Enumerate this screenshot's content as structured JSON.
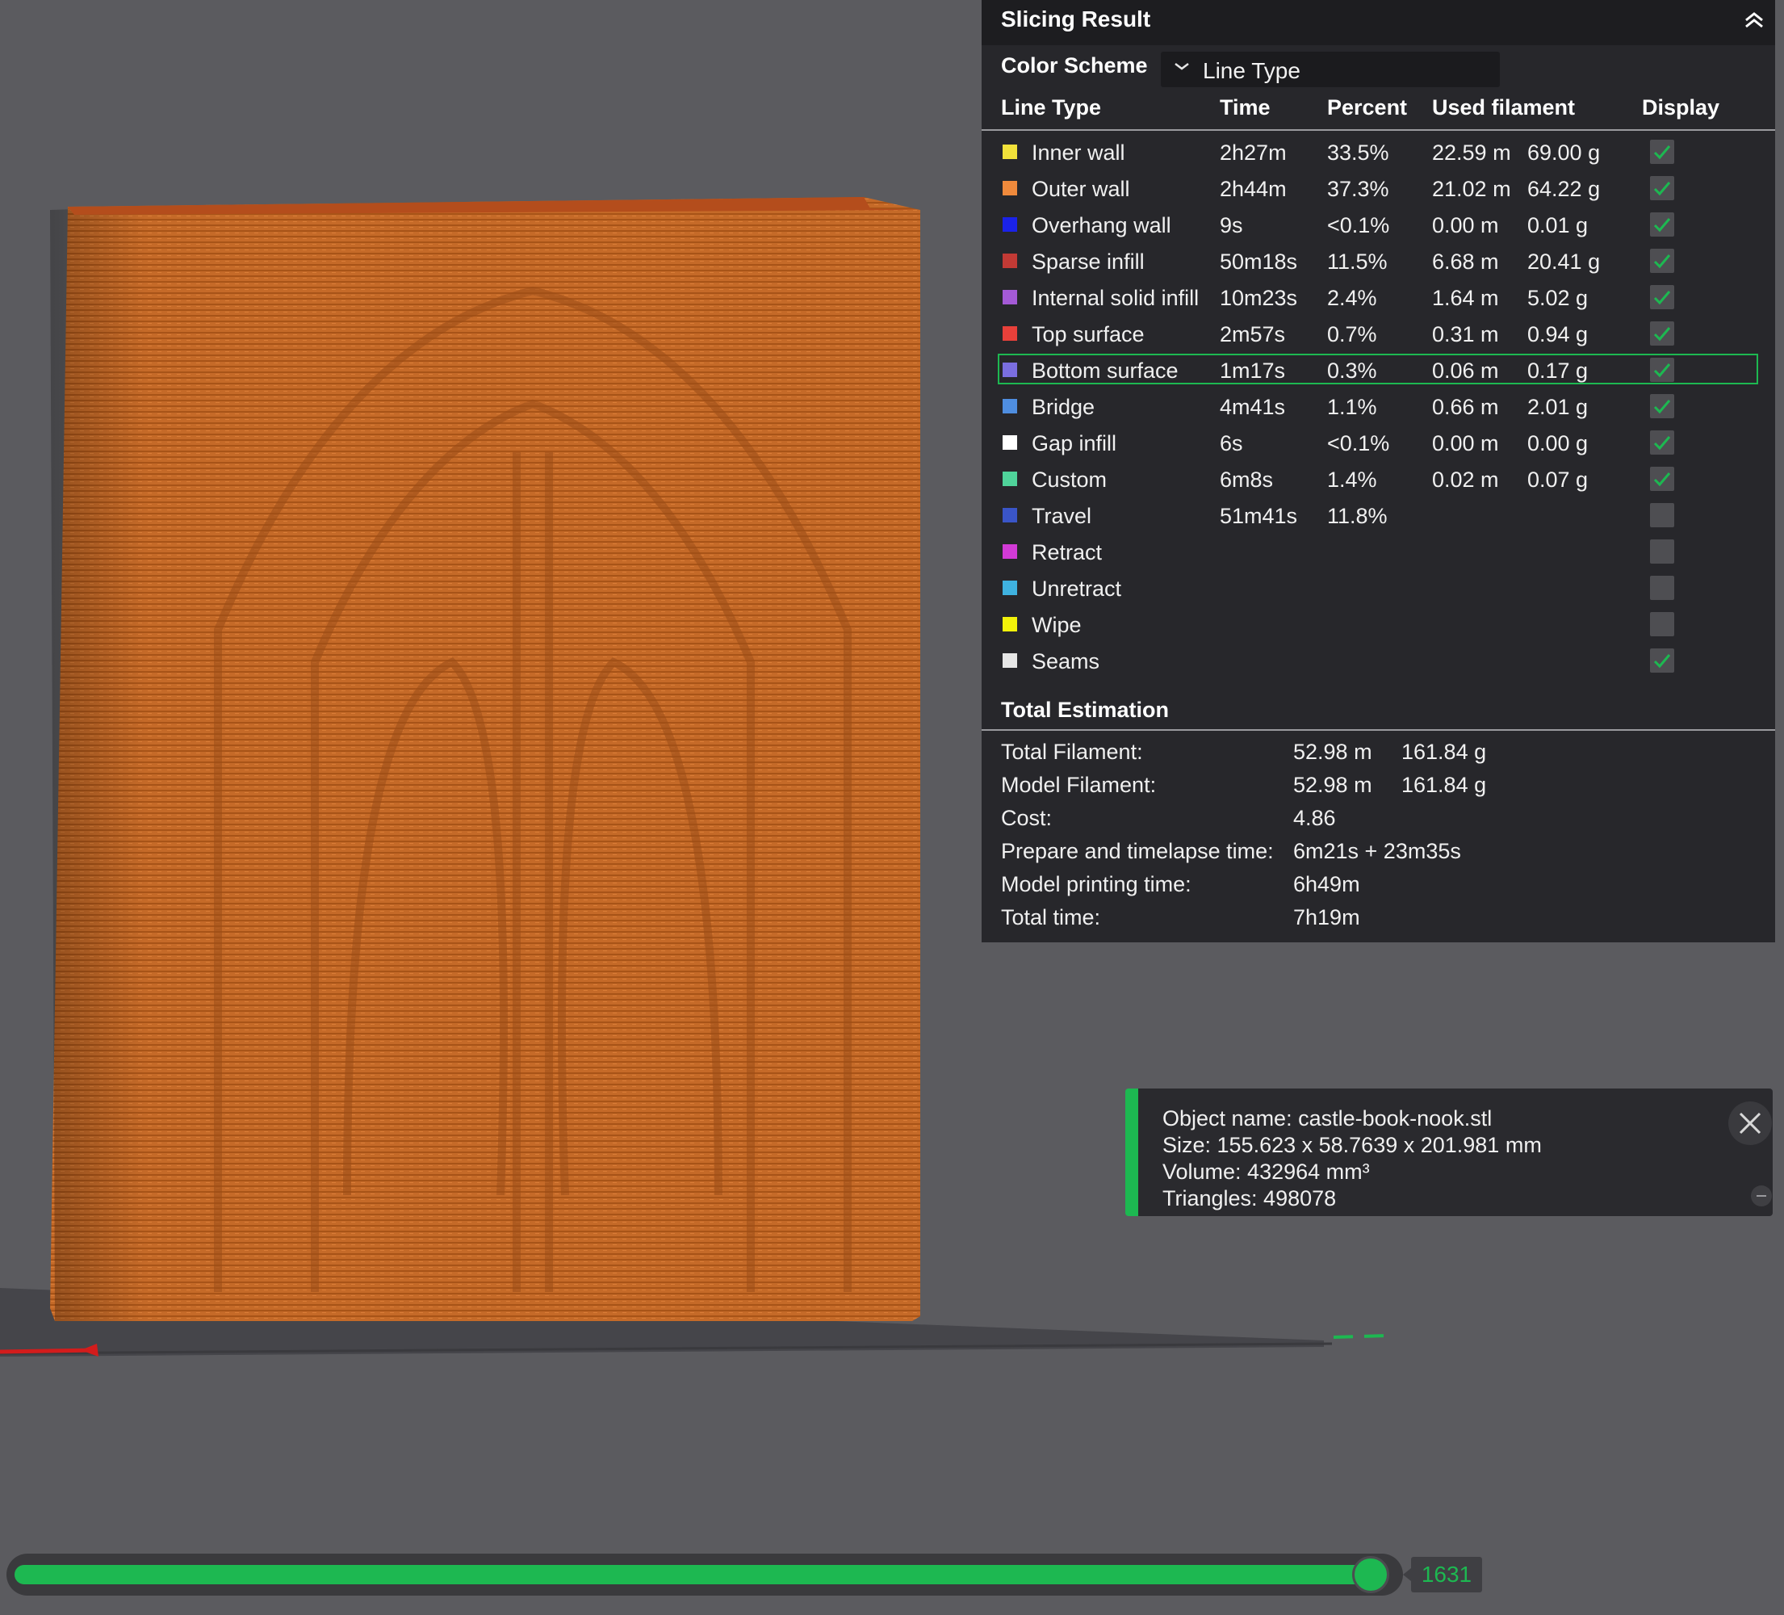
{
  "panel": {
    "title": "Slicing Result",
    "color_scheme_label": "Color Scheme",
    "color_scheme_value": "Line Type",
    "headers": {
      "line_type": "Line Type",
      "time": "Time",
      "percent": "Percent",
      "used_filament": "Used filament",
      "display": "Display"
    },
    "rows": [
      {
        "label": "Inner wall",
        "color": "#f2e23a",
        "time": "2h27m",
        "percent": "33.5%",
        "length": "22.59 m",
        "weight": "69.00 g",
        "display": true,
        "has_checkbox": true
      },
      {
        "label": "Outer wall",
        "color": "#f08a3c",
        "time": "2h44m",
        "percent": "37.3%",
        "length": "21.02 m",
        "weight": "64.22 g",
        "display": true,
        "has_checkbox": true
      },
      {
        "label": "Overhang wall",
        "color": "#1a22e8",
        "time": "9s",
        "percent": "<0.1%",
        "length": "0.00 m",
        "weight": "0.01 g",
        "display": true,
        "has_checkbox": true
      },
      {
        "label": "Sparse infill",
        "color": "#c23a35",
        "time": "50m18s",
        "percent": "11.5%",
        "length": "6.68 m",
        "weight": "20.41 g",
        "display": true,
        "has_checkbox": true
      },
      {
        "label": "Internal solid infill",
        "color": "#a45ad6",
        "time": "10m23s",
        "percent": "2.4%",
        "length": "1.64 m",
        "weight": "5.02 g",
        "display": true,
        "has_checkbox": true
      },
      {
        "label": "Top surface",
        "color": "#e8403a",
        "time": "2m57s",
        "percent": "0.7%",
        "length": "0.31 m",
        "weight": "0.94 g",
        "display": true,
        "has_checkbox": true
      },
      {
        "label": "Bottom surface",
        "color": "#7b6ee0",
        "time": "1m17s",
        "percent": "0.3%",
        "length": "0.06 m",
        "weight": "0.17 g",
        "display": true,
        "has_checkbox": true,
        "selected": true
      },
      {
        "label": "Bridge",
        "color": "#4f8ee0",
        "time": "4m41s",
        "percent": "1.1%",
        "length": "0.66 m",
        "weight": "2.01 g",
        "display": true,
        "has_checkbox": true
      },
      {
        "label": "Gap infill",
        "color": "#ffffff",
        "time": "6s",
        "percent": "<0.1%",
        "length": "0.00 m",
        "weight": "0.00 g",
        "display": true,
        "has_checkbox": true
      },
      {
        "label": "Custom",
        "color": "#4fd39a",
        "time": "6m8s",
        "percent": "1.4%",
        "length": "0.02 m",
        "weight": "0.07 g",
        "display": true,
        "has_checkbox": true
      },
      {
        "label": "Travel",
        "color": "#3a55c8",
        "time": "51m41s",
        "percent": "11.8%",
        "length": "",
        "weight": "",
        "display": false,
        "has_checkbox": true
      },
      {
        "label": "Retract",
        "color": "#d23ad6",
        "time": "",
        "percent": "",
        "length": "",
        "weight": "",
        "display": false,
        "has_checkbox": true
      },
      {
        "label": "Unretract",
        "color": "#3fb2e0",
        "time": "",
        "percent": "",
        "length": "",
        "weight": "",
        "display": false,
        "has_checkbox": true
      },
      {
        "label": "Wipe",
        "color": "#f2f20a",
        "time": "",
        "percent": "",
        "length": "",
        "weight": "",
        "display": false,
        "has_checkbox": true
      },
      {
        "label": "Seams",
        "color": "#e6e6e6",
        "time": "",
        "percent": "",
        "length": "",
        "weight": "",
        "display": true,
        "has_checkbox": true
      }
    ],
    "total_title": "Total Estimation",
    "totals": [
      {
        "key": "Total Filament:",
        "v1": "52.98 m",
        "v2": "161.84 g"
      },
      {
        "key": "Model Filament:",
        "v1": "52.98 m",
        "v2": "161.84 g"
      },
      {
        "key": "Cost:",
        "v1": "4.86",
        "v2": ""
      },
      {
        "key": "Prepare and timelapse time:",
        "v1": "6m21s + 23m35s",
        "v2": ""
      },
      {
        "key": "Model printing time:",
        "v1": "6h49m",
        "v2": ""
      },
      {
        "key": "Total time:",
        "v1": "7h19m",
        "v2": ""
      }
    ]
  },
  "object_info": {
    "name": "Object name: castle-book-nook.stl",
    "size": "Size: 155.623 x 58.7639 x 201.981 mm",
    "volume": "Volume: 432964 mm³",
    "triangles": "Triangles: 498078"
  },
  "slider": {
    "layer": "1631",
    "fraction": 1.0
  },
  "colors": {
    "accent": "#1db851",
    "background": "#5b5b5f",
    "panel": "#27272b",
    "model": "#c46a2a"
  },
  "icons": {
    "collapse": "double-chevron-up-icon",
    "dropdown": "chevron-down-icon",
    "check": "checkmark-icon",
    "close": "close-icon"
  }
}
